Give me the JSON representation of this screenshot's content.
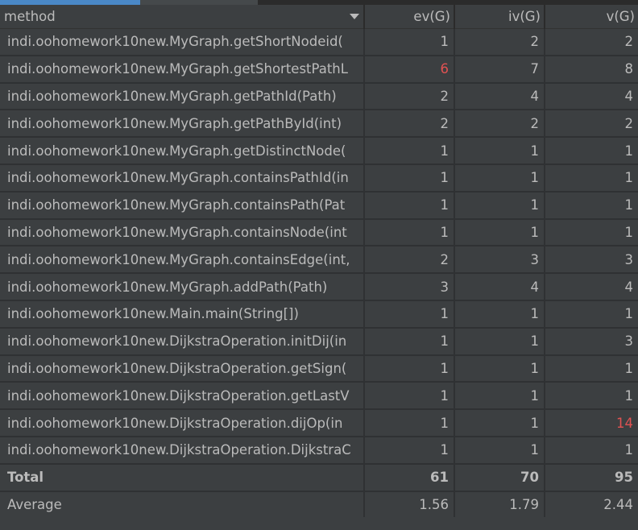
{
  "tabs": {
    "active_color": "#4a88c7",
    "inactive_color": "#45494b"
  },
  "table": {
    "columns": [
      "method",
      "ev(G)",
      "iv(G)",
      "v(G)"
    ],
    "sort_column": "method",
    "warning_color": "#e05252",
    "rows": [
      {
        "method": "indi.oohomework10new.MyGraph.getShortNodeid(",
        "ev": "1",
        "iv": "2",
        "v": "2"
      },
      {
        "method": "indi.oohomework10new.MyGraph.getShortestPathL",
        "ev": "6",
        "iv": "7",
        "v": "8",
        "ev_warn": true
      },
      {
        "method": "indi.oohomework10new.MyGraph.getPathId(Path)",
        "ev": "2",
        "iv": "4",
        "v": "4"
      },
      {
        "method": "indi.oohomework10new.MyGraph.getPathById(int)",
        "ev": "2",
        "iv": "2",
        "v": "2"
      },
      {
        "method": "indi.oohomework10new.MyGraph.getDistinctNode(",
        "ev": "1",
        "iv": "1",
        "v": "1"
      },
      {
        "method": "indi.oohomework10new.MyGraph.containsPathId(in",
        "ev": "1",
        "iv": "1",
        "v": "1"
      },
      {
        "method": "indi.oohomework10new.MyGraph.containsPath(Pat",
        "ev": "1",
        "iv": "1",
        "v": "1"
      },
      {
        "method": "indi.oohomework10new.MyGraph.containsNode(int",
        "ev": "1",
        "iv": "1",
        "v": "1"
      },
      {
        "method": "indi.oohomework10new.MyGraph.containsEdge(int,",
        "ev": "2",
        "iv": "3",
        "v": "3"
      },
      {
        "method": "indi.oohomework10new.MyGraph.addPath(Path)",
        "ev": "3",
        "iv": "4",
        "v": "4"
      },
      {
        "method": "indi.oohomework10new.Main.main(String[])",
        "ev": "1",
        "iv": "1",
        "v": "1"
      },
      {
        "method": "indi.oohomework10new.DijkstraOperation.initDij(in",
        "ev": "1",
        "iv": "1",
        "v": "3"
      },
      {
        "method": "indi.oohomework10new.DijkstraOperation.getSign(",
        "ev": "1",
        "iv": "1",
        "v": "1"
      },
      {
        "method": "indi.oohomework10new.DijkstraOperation.getLastV",
        "ev": "1",
        "iv": "1",
        "v": "1"
      },
      {
        "method": "indi.oohomework10new.DijkstraOperation.dijOp(in",
        "ev": "1",
        "iv": "1",
        "v": "14",
        "v_warn": true
      },
      {
        "method": "indi.oohomework10new.DijkstraOperation.DijkstraC",
        "ev": "1",
        "iv": "1",
        "v": "1"
      }
    ],
    "total": {
      "label": "Total",
      "ev": "61",
      "iv": "70",
      "v": "95"
    },
    "average": {
      "label": "Average",
      "ev": "1.56",
      "iv": "1.79",
      "v": "2.44"
    }
  }
}
